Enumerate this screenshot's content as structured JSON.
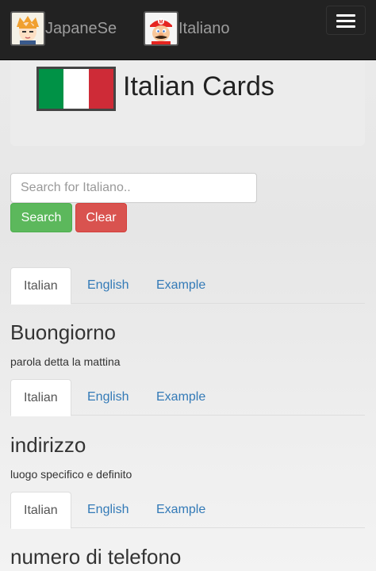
{
  "nav": {
    "links": [
      {
        "label": "JapaneSe"
      },
      {
        "label": "Italiano"
      }
    ]
  },
  "jumbotron": {
    "title": "Italian Cards",
    "flag_colors": [
      "#009246",
      "#ffffff",
      "#ce2b37"
    ]
  },
  "search": {
    "placeholder": "Search for Italiano..",
    "value": "",
    "search_label": "Search",
    "clear_label": "Clear"
  },
  "cards": [
    {
      "tabs": [
        "Italian",
        "English",
        "Example"
      ],
      "active_tab": "Italian",
      "title": "Buongiorno",
      "description": "parola detta la mattina"
    },
    {
      "tabs": [
        "Italian",
        "English",
        "Example"
      ],
      "active_tab": "Italian",
      "title": "indirizzo",
      "description": "luogo specifico e definito"
    },
    {
      "tabs": [
        "Italian",
        "English",
        "Example"
      ],
      "active_tab": "Italian",
      "title": "numero di telefono",
      "description": ""
    }
  ],
  "colors": {
    "navbar_bg": "#222222",
    "link": "#337ab7",
    "success": "#5cb85c",
    "danger": "#d9534f"
  }
}
